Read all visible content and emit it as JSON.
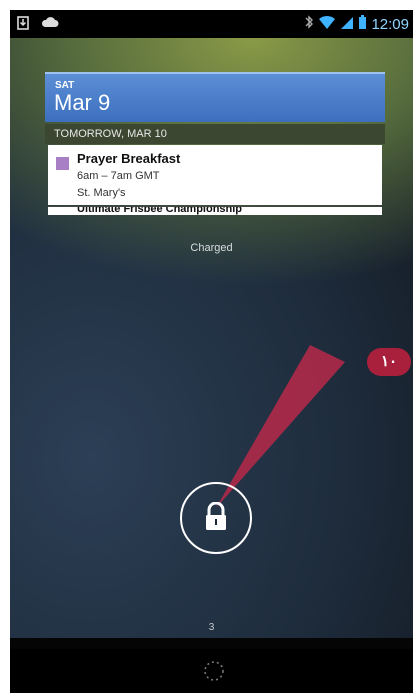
{
  "status_bar": {
    "time": "12:09",
    "left_icons": [
      "download-icon",
      "cloud-icon"
    ],
    "right_icons": [
      "bluetooth-icon",
      "wifi-icon",
      "signal-icon",
      "battery-icon"
    ]
  },
  "calendar_widget": {
    "day": "SAT",
    "date": "Mar 9",
    "tomorrow_label": "TOMORROW, MAR 10",
    "event": {
      "title": "Prayer Breakfast",
      "time": "6am – 7am GMT",
      "location": "St. Mary's",
      "color": "#a87fc4"
    },
    "next_event_partial": "Ultimate Frisbee Championship"
  },
  "charging_status": "Charged",
  "lock_icon": "lock-icon",
  "page_indicator": "3",
  "callout": {
    "label": "١٠",
    "color": "#a8203b"
  },
  "nav": {
    "home_indicator": "dotted-circle-icon"
  }
}
